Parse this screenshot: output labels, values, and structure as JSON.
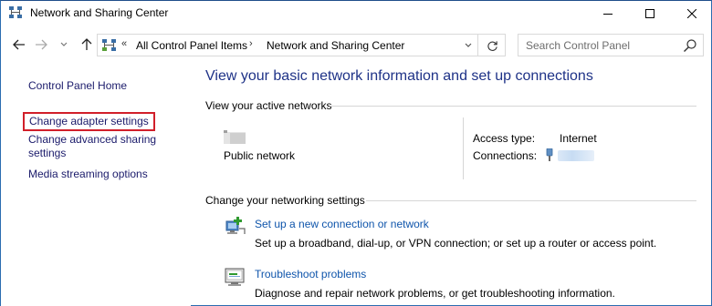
{
  "window": {
    "title": "Network and Sharing Center"
  },
  "address": {
    "separator": "«",
    "crumbs": [
      "All Control Panel Items",
      "Network and Sharing Center"
    ],
    "crumb_arrow": "›"
  },
  "search": {
    "placeholder": "Search Control Panel"
  },
  "sidebar": {
    "items": [
      {
        "label": "Control Panel Home"
      },
      {
        "label": "Change adapter settings",
        "highlighted": true,
        "highlight_color": "#d11f2a"
      },
      {
        "label": "Change advanced sharing settings"
      },
      {
        "label": "Media streaming options"
      }
    ]
  },
  "main": {
    "title": "View your basic network information and set up connections",
    "active_section_label": "View your active networks",
    "network": {
      "name": "Public network",
      "access_type_label": "Access type:",
      "access_type_value": "Internet",
      "connections_label": "Connections:"
    },
    "change_section_label": "Change your networking settings",
    "tasks": [
      {
        "link": "Set up a new connection or network",
        "description": "Set up a broadband, dial-up, or VPN connection; or set up a router or access point.",
        "icon": "network-setup-icon"
      },
      {
        "link": "Troubleshoot problems",
        "description": "Diagnose and repair network problems, or get troubleshooting information.",
        "icon": "troubleshoot-icon"
      }
    ]
  },
  "colors": {
    "title_blue": "#1e3287",
    "link_blue": "#0f55ab",
    "sidebar_link": "#1b1b6b",
    "highlight_red": "#d11f2a"
  }
}
